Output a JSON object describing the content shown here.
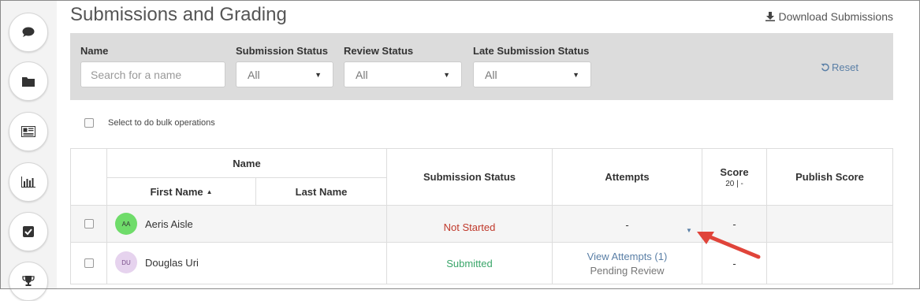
{
  "page": {
    "title": "Submissions and Grading",
    "download_label": "Download Submissions"
  },
  "sidebar": {
    "items": [
      {
        "name": "chat",
        "icon": "chat-bubble-icon"
      },
      {
        "name": "folder",
        "icon": "folder-icon"
      },
      {
        "name": "newspaper",
        "icon": "newspaper-icon"
      },
      {
        "name": "analytics",
        "icon": "bar-chart-icon"
      },
      {
        "name": "grading",
        "icon": "checkbox-icon"
      },
      {
        "name": "achievements",
        "icon": "trophy-icon"
      }
    ]
  },
  "filters": {
    "name_label": "Name",
    "name_placeholder": "Search for a name",
    "submission_status_label": "Submission Status",
    "submission_status_value": "All",
    "review_status_label": "Review Status",
    "review_status_value": "All",
    "late_submission_status_label": "Late Submission Status",
    "late_submission_status_value": "All",
    "reset_label": "Reset"
  },
  "bulk": {
    "label": "Select to do bulk operations"
  },
  "table": {
    "headers": {
      "name_group": "Name",
      "first_name": "First Name",
      "last_name": "Last Name",
      "submission_status": "Submission Status",
      "attempts": "Attempts",
      "score": "Score",
      "score_sub": "20 | -",
      "publish_score": "Publish Score"
    },
    "rows": [
      {
        "initials": "AA",
        "avatar_color": "#6fdc6a",
        "name": "Aeris Aisle",
        "submission_status": "Not Started",
        "status_color": "#c0392b",
        "attempts": "-",
        "score": "-"
      },
      {
        "initials": "DU",
        "avatar_color": "#e6d3ee",
        "name": "Douglas Uri",
        "submission_status": "Submitted",
        "status_color": "#3aa66a",
        "attempts_link": "View Attempts (1)",
        "attempts_status": "Pending Review",
        "score": "-"
      }
    ]
  },
  "colors": {
    "filter_bg": "#dcdcdc",
    "link": "#5a7fa6",
    "annotation_arrow": "#e0443a"
  }
}
